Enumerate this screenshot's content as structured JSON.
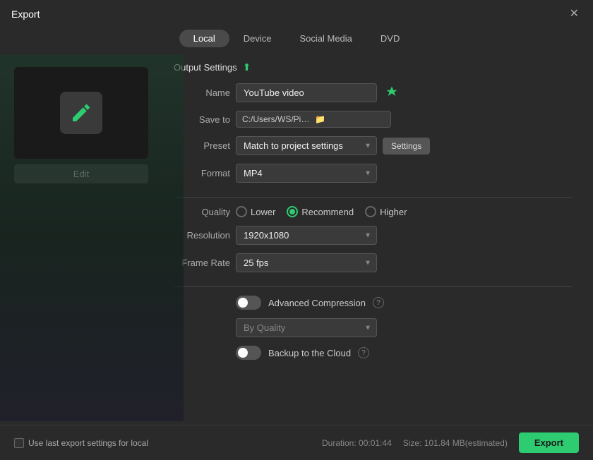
{
  "window": {
    "title": "Export",
    "close_label": "✕"
  },
  "tabs": [
    {
      "id": "local",
      "label": "Local",
      "active": true
    },
    {
      "id": "device",
      "label": "Device",
      "active": false
    },
    {
      "id": "social_media",
      "label": "Social Media",
      "active": false
    },
    {
      "id": "dvd",
      "label": "DVD",
      "active": false
    }
  ],
  "preview": {
    "edit_label": "Edit"
  },
  "output_settings": {
    "header": "Output Settings",
    "fields": {
      "name_label": "Name",
      "name_value": "YouTube video",
      "save_to_label": "Save to",
      "save_to_path": "C:/Users/WS/Pictures/marvel",
      "preset_label": "Preset",
      "preset_value": "Match to project settings",
      "settings_label": "Settings",
      "format_label": "Format",
      "format_value": "MP4",
      "quality_label": "Quality",
      "quality_lower": "Lower",
      "quality_recommend": "Recommend",
      "quality_higher": "Higher",
      "resolution_label": "Resolution",
      "resolution_value": "1920x1080",
      "frame_rate_label": "Frame Rate",
      "frame_rate_value": "25 fps"
    },
    "advanced_compression": {
      "label": "Advanced Compression",
      "enabled": false
    },
    "by_quality": {
      "label": "By Quality",
      "placeholder": "By Quality"
    },
    "backup_cloud": {
      "label": "Backup to the Cloud",
      "enabled": false
    }
  },
  "footer": {
    "checkbox_label": "Use last export settings for local",
    "duration_label": "Duration: 00:01:44",
    "size_label": "Size: 101.84 MB(estimated)",
    "export_label": "Export"
  }
}
